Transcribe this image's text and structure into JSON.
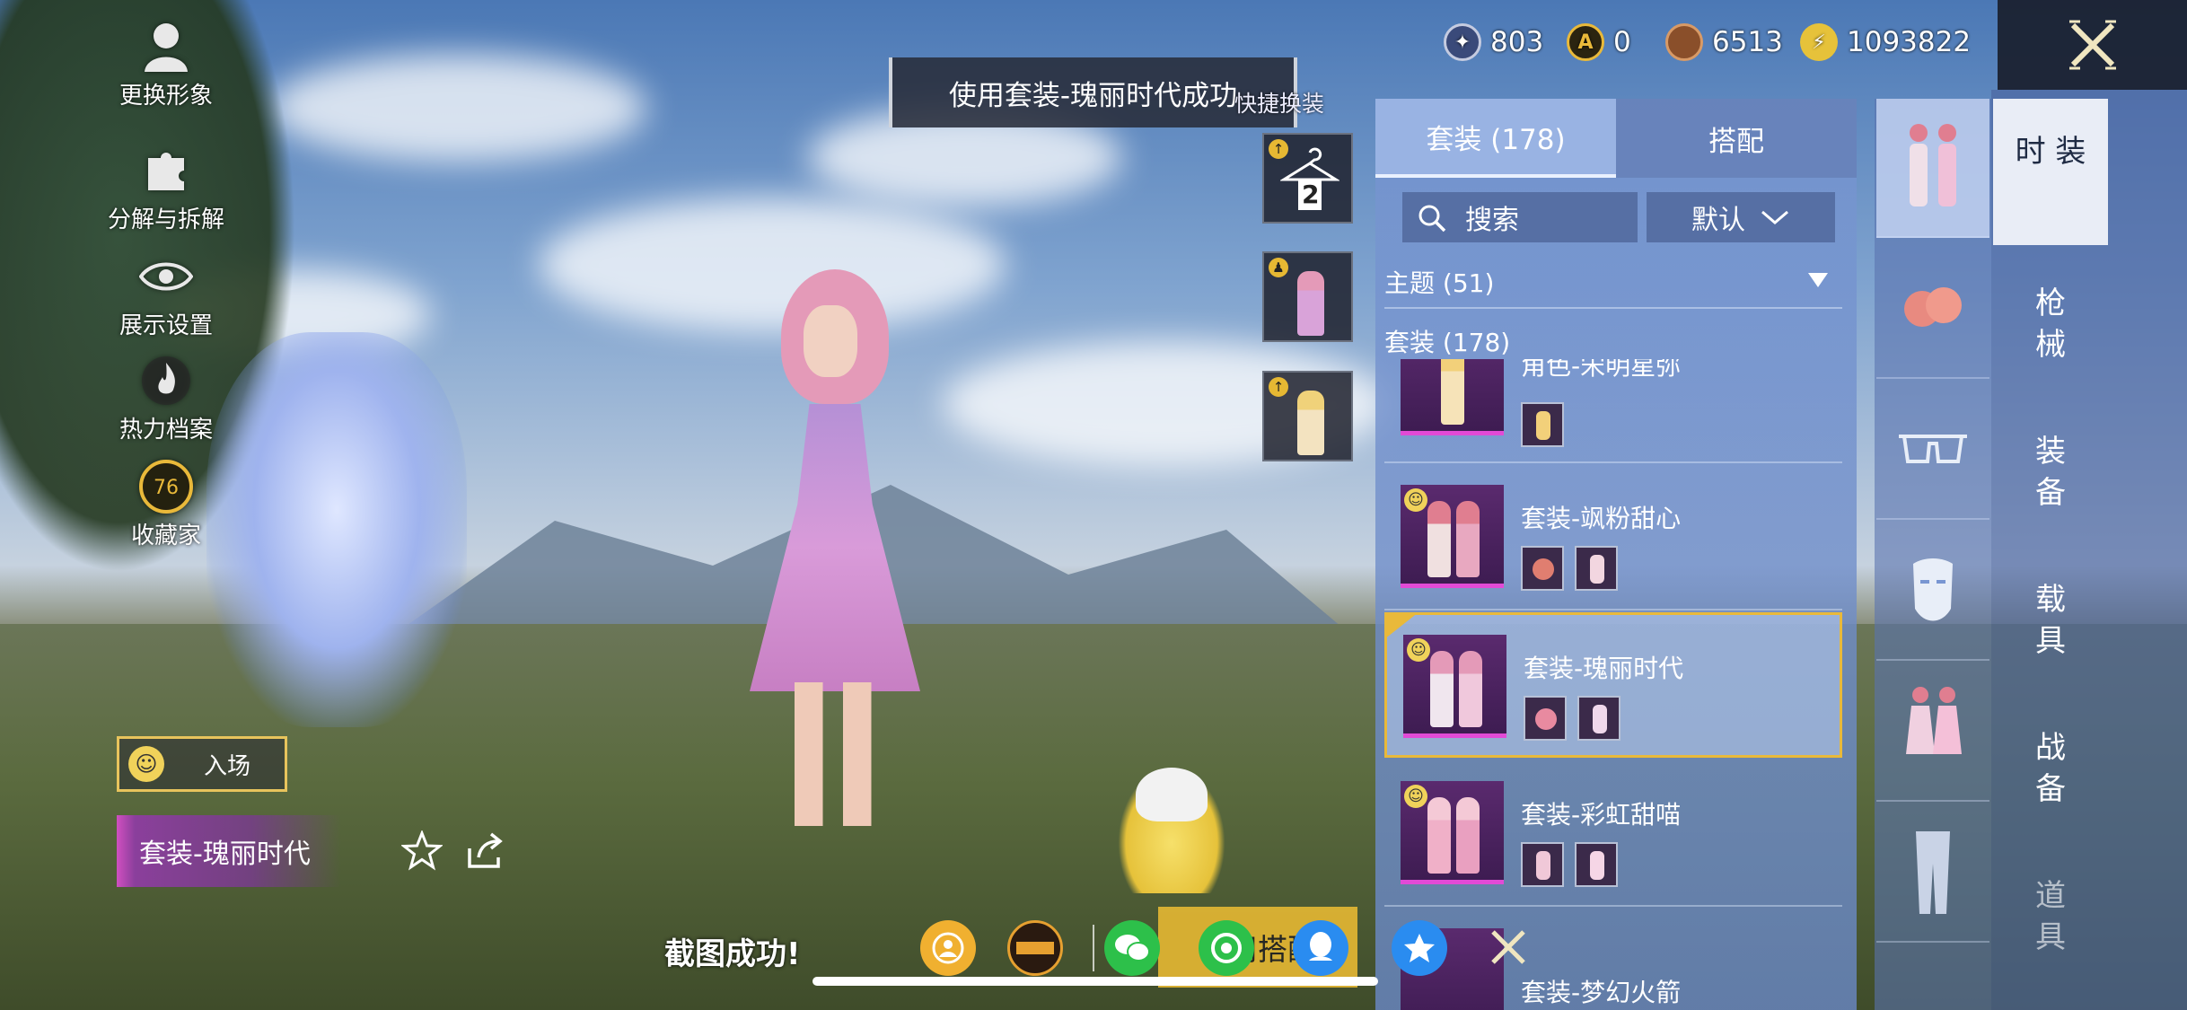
{
  "left_menu": {
    "change_look": "更换形象",
    "decompose": "分解与拆解",
    "display_settings": "展示设置",
    "heat_profile": "热力档案",
    "collector": "收藏家",
    "collector_level": "76"
  },
  "entrance": {
    "label": "入场"
  },
  "current_outfit": "套装-瑰丽时代",
  "toast": "使用套装-瑰丽时代成功",
  "quick_change": {
    "label": "快捷换装",
    "slot_count": "2"
  },
  "currency": {
    "c1": "803",
    "c2": "0",
    "c3": "6513",
    "c4": "1093822"
  },
  "panel": {
    "tabs": [
      "套装 (178)",
      "搭配"
    ],
    "search_label": "搜索",
    "sort_label": "默认",
    "theme_section": "主题 (51)",
    "outfit_section": "套装 (178)",
    "items": [
      {
        "name": "角色-宋明星弥"
      },
      {
        "name": "套装-飒粉甜心"
      },
      {
        "name": "套装-瑰丽时代"
      },
      {
        "name": "套装-彩虹甜喵"
      },
      {
        "name": "套装-梦幻火箭"
      }
    ]
  },
  "side_nav": [
    "时\n装",
    "枪\n械",
    "装\n备",
    "载\n具",
    "战\n备",
    "道\n具"
  ],
  "share_bar": {
    "screenshot_success": "截图成功!",
    "use_outfit": "使用搭配"
  },
  "colors": {
    "accent_gold": "#e9b93a",
    "rarity_pink": "#e24ad6",
    "panel_blue": "#7896d2"
  }
}
